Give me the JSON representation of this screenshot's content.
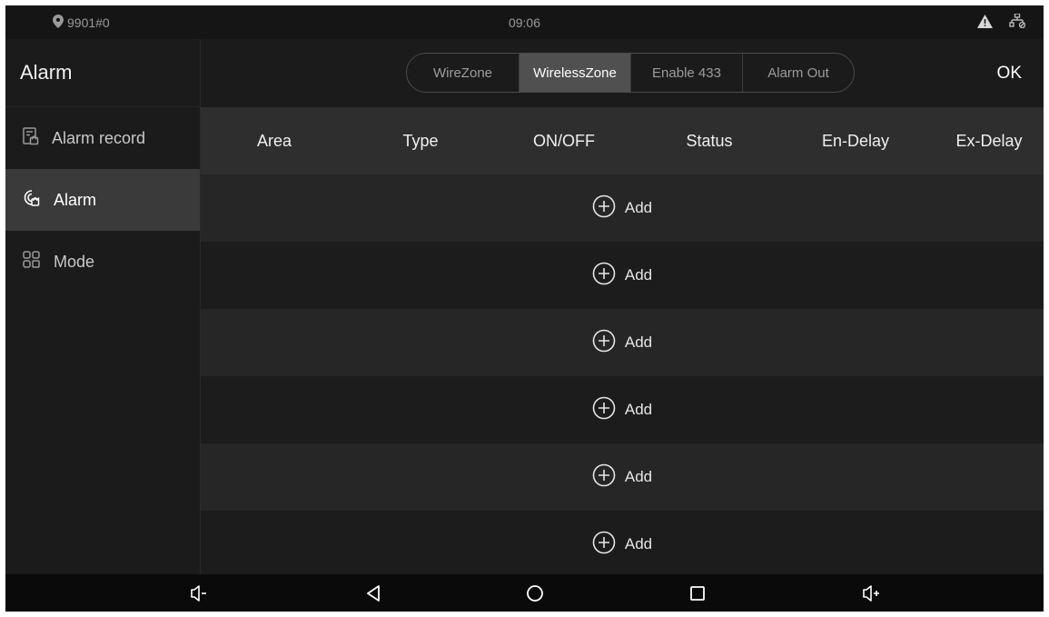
{
  "status_bar": {
    "location": "9901#0",
    "time": "09:06",
    "icons": [
      "location-pin-icon",
      "warning-icon",
      "network-icon"
    ]
  },
  "sidebar": {
    "title": "Alarm",
    "items": [
      {
        "label": "Alarm record",
        "icon": "alarm-record-icon",
        "active": false
      },
      {
        "label": "Alarm",
        "icon": "alarm-icon",
        "active": true
      },
      {
        "label": "Mode",
        "icon": "mode-grid-icon",
        "active": false
      }
    ]
  },
  "header": {
    "tabs": [
      {
        "label": "WireZone",
        "active": false
      },
      {
        "label": "WirelessZone",
        "active": true
      },
      {
        "label": "Enable 433",
        "active": false
      },
      {
        "label": "Alarm Out",
        "active": false
      }
    ],
    "ok_label": "OK"
  },
  "table": {
    "columns": [
      "Area",
      "Type",
      "ON/OFF",
      "Status",
      "En-Delay",
      "Ex-Delay"
    ],
    "rows": [
      {
        "label": "Add"
      },
      {
        "label": "Add"
      },
      {
        "label": "Add"
      },
      {
        "label": "Add"
      },
      {
        "label": "Add"
      },
      {
        "label": "Add"
      }
    ]
  },
  "nav_bar": {
    "buttons": [
      "volume-down-icon",
      "back-icon",
      "home-icon",
      "recents-icon",
      "volume-up-icon"
    ]
  },
  "colors": {
    "background": "#1b1b1b",
    "active_tab": "#505050",
    "header_row": "#2e2e2e",
    "nav_bar": "#0a0a0a"
  }
}
